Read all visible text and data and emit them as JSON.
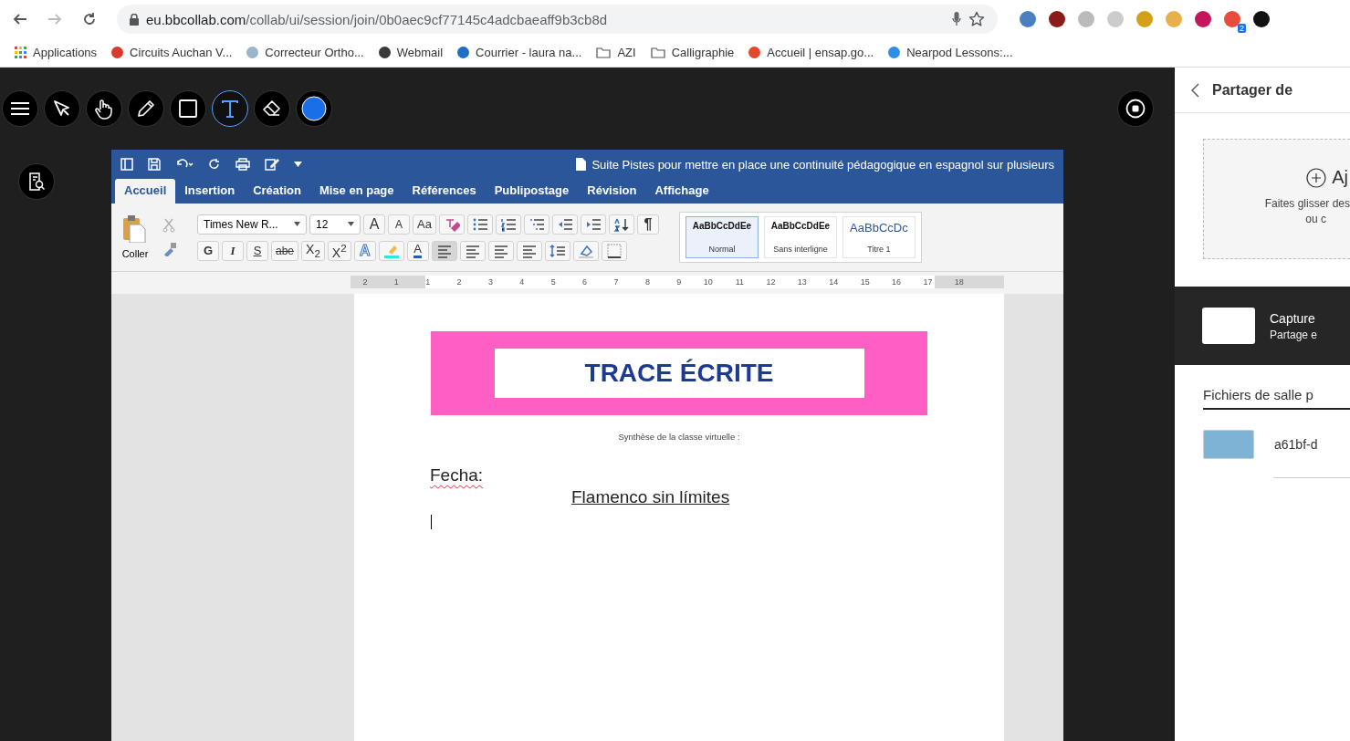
{
  "browser": {
    "url_host": "eu.bbcollab.com",
    "url_path": "/collab/ui/session/join/0b0aec9cf77145c4adcbaeaff9b3cb8d",
    "extension_badge": "2",
    "bookmarks": [
      {
        "kind": "apps",
        "label": "Applications"
      },
      {
        "kind": "site",
        "label": "Circuits Auchan V...",
        "color": "#d93a2b"
      },
      {
        "kind": "site",
        "label": "Correcteur Ortho...",
        "color": "#9bb4c8"
      },
      {
        "kind": "site",
        "label": "Webmail",
        "color": "#3a3a3a"
      },
      {
        "kind": "site",
        "label": "Courrier - laura na...",
        "color": "#1f6fc5"
      },
      {
        "kind": "folder",
        "label": "AZI"
      },
      {
        "kind": "folder",
        "label": "Calligraphie"
      },
      {
        "kind": "site",
        "label": "Accueil | ensap.go...",
        "color": "#e0492f"
      },
      {
        "kind": "site",
        "label": "Nearpod Lessons:...",
        "color": "#2f8fe8"
      }
    ]
  },
  "toolbar": {
    "tools": [
      {
        "kind": "menu",
        "selected": false
      },
      {
        "kind": "pointer",
        "selected": false
      },
      {
        "kind": "hand",
        "selected": false
      },
      {
        "kind": "pencil",
        "selected": false
      },
      {
        "kind": "shape",
        "selected": false
      },
      {
        "kind": "text",
        "selected": true
      },
      {
        "kind": "eraser",
        "selected": false
      },
      {
        "kind": "color",
        "selected": false
      }
    ]
  },
  "word": {
    "title": "Suite Pistes pour mettre en place une continuité pédagogique en espagnol sur plusieurs",
    "tabs": [
      {
        "label": "Accueil",
        "selected": true
      },
      {
        "label": "Insertion",
        "selected": false
      },
      {
        "label": "Création",
        "selected": false
      },
      {
        "label": "Mise en page",
        "selected": false
      },
      {
        "label": "Références",
        "selected": false
      },
      {
        "label": "Publipostage",
        "selected": false
      },
      {
        "label": "Révision",
        "selected": false
      },
      {
        "label": "Affichage",
        "selected": false
      }
    ],
    "paste_label": "Coller",
    "font": "Times New R...",
    "size": "12",
    "row1": [
      {
        "kind": "grow",
        "label": "A"
      },
      {
        "kind": "shrink",
        "label": "A"
      },
      {
        "kind": "case",
        "label": "Aa"
      },
      {
        "kind": "clear"
      },
      {
        "kind": "bullets"
      },
      {
        "kind": "numbering"
      },
      {
        "kind": "multilevel"
      },
      {
        "kind": "outdent"
      },
      {
        "kind": "indent"
      },
      {
        "kind": "sort"
      },
      {
        "kind": "pilcrow",
        "label": "¶"
      }
    ],
    "row2": [
      {
        "kind": "bold",
        "label": "G"
      },
      {
        "kind": "italic",
        "label": "I"
      },
      {
        "kind": "underline",
        "label": "S"
      },
      {
        "kind": "strike",
        "label": "abe"
      },
      {
        "kind": "script",
        "label": "X$_{2}$"
      },
      {
        "kind": "script",
        "label": "X$^{2}$"
      },
      {
        "kind": "effects",
        "label": "A"
      },
      {
        "kind": "highlight"
      },
      {
        "kind": "fontcolor",
        "label": "A"
      },
      {
        "kind": "align",
        "selected": true
      },
      {
        "kind": "align",
        "selected": false
      },
      {
        "kind": "align",
        "selected": false
      },
      {
        "kind": "align",
        "selected": false
      },
      {
        "kind": "spacing"
      },
      {
        "kind": "shading"
      },
      {
        "kind": "borders"
      }
    ],
    "styles": [
      {
        "preview": "AaBbCcDdEe",
        "name": "Normal",
        "selected": true
      },
      {
        "preview": "AaBbCcDdEe",
        "name": "Sans interligne",
        "selected": false
      },
      {
        "preview": "AaBbCcDc",
        "name": "Titre 1",
        "selected": false
      }
    ],
    "ruler": [
      "2",
      "1",
      "1",
      "2",
      "3",
      "4",
      "5",
      "6",
      "7",
      "8",
      "9",
      "10",
      "11",
      "12",
      "13",
      "14",
      "15",
      "16",
      "17",
      "18"
    ]
  },
  "document": {
    "banner_title": "TRACE ÉCRITE",
    "subtitle": "Synthèse de la classe virtuelle :",
    "date_label": "Fecha:",
    "heading": "Flamenco sin límites"
  },
  "panel": {
    "title": "Partager de",
    "add_label": "Aj",
    "drop_hint": "Faites glisser des",
    "drop_hint_2": "ou c",
    "shared": {
      "title": "Capture",
      "subtitle": "Partage e"
    },
    "section_title": "Fichiers de salle p",
    "files": [
      {
        "name": "a61bf-d"
      }
    ]
  }
}
